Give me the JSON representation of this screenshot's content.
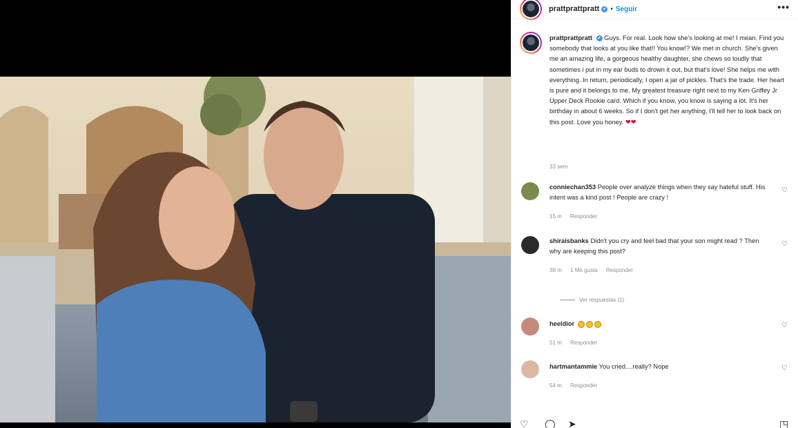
{
  "post": {
    "username": "prattprattpratt",
    "verified_mark": "✔",
    "separator": "•",
    "follow_label": "Seguir",
    "more_label": "•••"
  },
  "caption": {
    "username": "prattprattpratt",
    "text": "Guys. For real. Look how she's looking at me! I mean. Find you somebody that looks at you like that!! You know!? We met in church. She's given me an amazing life, a gorgeous healthy daughter, she chews so loudly that sometimes i put in my ear buds to drown it out, but that's love! She helps me with everything. In return, periodically, I open a jar of pickles. That's the trade. Her heart is pure and it belongs to me. My greatest treasure right next to my Ken Griffey Jr Upper Deck Rookie card. Which if you know, you know is saying a lot. It's her birthday in about 6 weeks. So if I don't get her anything, I'll tell her to look back on this post. Love you honey.",
    "emoji": "❤❤",
    "time": "33 sem"
  },
  "comments": [
    {
      "user": "conniechan353",
      "text": "People over analyze things when they say hateful stuff. His intent was a kind post ! People are crazy !",
      "time": "15 m",
      "likes": "",
      "reply": "Responder",
      "avatar_color": "#7a8b4a"
    },
    {
      "user": "shiraisbanks",
      "text": "Didn't you cry and feel bad that your son might read ? Then why are keeping this post?",
      "time": "38 m",
      "likes": "1 Me gusta",
      "reply": "Responder",
      "avatar_color": "#2a2a2a",
      "view_replies": "Ver respuestas (1)"
    },
    {
      "user": "heeldior",
      "text": "",
      "time": "51 m",
      "likes": "",
      "reply": "Responder",
      "avatar_color": "#c58a7a"
    },
    {
      "user": "hartmantammie",
      "text": "You cried....really? Nope",
      "time": "54 m",
      "likes": "",
      "reply": "Responder",
      "avatar_color": "#d9b8a6"
    }
  ],
  "icons": {
    "heart": "heart-icon",
    "like": "♡",
    "comment": "◯",
    "share": "➤",
    "save": "◳"
  },
  "colors": {
    "link_blue": "#0095f6",
    "verified": "#3897f0",
    "muted": "#8e8e8e",
    "text": "#262626"
  }
}
